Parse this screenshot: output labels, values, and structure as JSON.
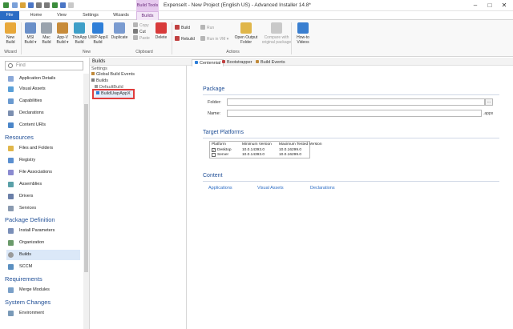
{
  "colors": {
    "accent": "#2b6cc4",
    "context_tab": "#e6c9ee",
    "section_heading": "#1f4e96",
    "selection_highlight": "#e03c3c"
  },
  "titlebar": {
    "context_tab_label": "Build Tools",
    "window_title": "ExpenseIt - New Project (English US) - Advanced Installer 14.8*",
    "minimize": "–",
    "maximize": "□",
    "close": "✕"
  },
  "tabs": [
    "File",
    "Home",
    "View",
    "Settings",
    "Wizards",
    "Builds"
  ],
  "ribbon": {
    "new_build": "New\nBuild",
    "msi_build": "MSI\nBuild ▾",
    "mac_build": "Mac\nBuild",
    "appv_build": "App-V\nBuild ▾",
    "thinapp_build": "ThinApp\nBuild",
    "uwp_build": "UWP AppX\nBuild",
    "duplicate": "Duplicate",
    "copy": "Copy",
    "cut": "Cut",
    "paste": "Paste",
    "delete": "Delete",
    "build": "Build",
    "rebuild": "Rebuild",
    "run": "Run",
    "run_in_vm": "Run in VM ▾",
    "open_output": "Open Output\nFolder",
    "compare": "Compare with\noriginal package",
    "howto": "How-to\nVideos",
    "groups": {
      "wizard": "Wizard",
      "new": "New",
      "clipboard": "Clipboard",
      "actions": "Actions"
    }
  },
  "sidebar": {
    "search_placeholder": "Find",
    "items_top": [
      "Application Details",
      "Visual Assets",
      "Capabilities",
      "Declarations",
      "Content URIs"
    ],
    "sections": {
      "resources": "Resources",
      "package_definition": "Package Definition",
      "requirements": "Requirements",
      "system_changes": "System Changes"
    },
    "resources_items": [
      "Files and Folders",
      "Registry",
      "File Associations",
      "Assemblies",
      "Drivers",
      "Services"
    ],
    "package_items": [
      "Install Parameters",
      "Organization",
      "Builds",
      "SCCM"
    ],
    "requirements_items": [
      "Merge Modules"
    ],
    "system_items": [
      "Environment"
    ]
  },
  "builds_panel": {
    "title": "Builds",
    "tree": [
      "Settings",
      "Global Build Events",
      "Builds",
      "DefaultBuild",
      "BuildUwpAppX"
    ]
  },
  "main": {
    "tabs": [
      "Centennial",
      "Bootstrapper",
      "Build Events"
    ],
    "package": {
      "title": "Package",
      "folder_label": "Folder:",
      "name_label": "Name:",
      "browse": "...",
      "suffix": ".appx"
    },
    "target_platforms": {
      "title": "Target Platforms",
      "headers": [
        "Platform",
        "Minimum Version",
        "Maximum Tested Version"
      ],
      "rows": [
        {
          "platform": "Desktop",
          "min": "10.0.14393.0",
          "max": "10.0.16299.0",
          "checked": "✓"
        },
        {
          "platform": "Server",
          "min": "10.0.14393.0",
          "max": "10.0.16299.0",
          "checked": ""
        }
      ]
    },
    "content": {
      "title": "Content",
      "links": [
        "Applications",
        "Visual Assets",
        "Declarations"
      ]
    }
  }
}
